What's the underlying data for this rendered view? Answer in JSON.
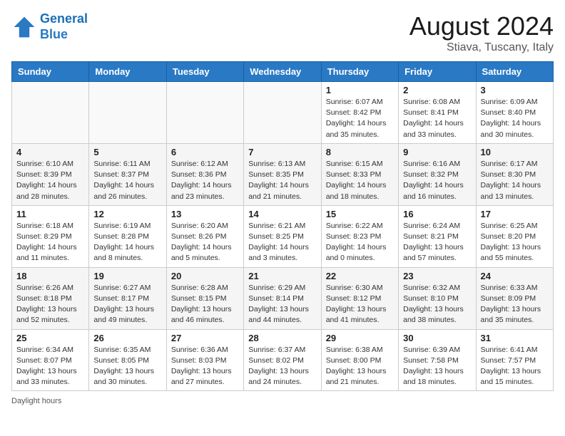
{
  "header": {
    "logo_line1": "General",
    "logo_line2": "Blue",
    "month": "August 2024",
    "location": "Stiava, Tuscany, Italy"
  },
  "weekdays": [
    "Sunday",
    "Monday",
    "Tuesday",
    "Wednesday",
    "Thursday",
    "Friday",
    "Saturday"
  ],
  "weeks": [
    [
      {
        "day": "",
        "info": ""
      },
      {
        "day": "",
        "info": ""
      },
      {
        "day": "",
        "info": ""
      },
      {
        "day": "",
        "info": ""
      },
      {
        "day": "1",
        "info": "Sunrise: 6:07 AM\nSunset: 8:42 PM\nDaylight: 14 hours\nand 35 minutes."
      },
      {
        "day": "2",
        "info": "Sunrise: 6:08 AM\nSunset: 8:41 PM\nDaylight: 14 hours\nand 33 minutes."
      },
      {
        "day": "3",
        "info": "Sunrise: 6:09 AM\nSunset: 8:40 PM\nDaylight: 14 hours\nand 30 minutes."
      }
    ],
    [
      {
        "day": "4",
        "info": "Sunrise: 6:10 AM\nSunset: 8:39 PM\nDaylight: 14 hours\nand 28 minutes."
      },
      {
        "day": "5",
        "info": "Sunrise: 6:11 AM\nSunset: 8:37 PM\nDaylight: 14 hours\nand 26 minutes."
      },
      {
        "day": "6",
        "info": "Sunrise: 6:12 AM\nSunset: 8:36 PM\nDaylight: 14 hours\nand 23 minutes."
      },
      {
        "day": "7",
        "info": "Sunrise: 6:13 AM\nSunset: 8:35 PM\nDaylight: 14 hours\nand 21 minutes."
      },
      {
        "day": "8",
        "info": "Sunrise: 6:15 AM\nSunset: 8:33 PM\nDaylight: 14 hours\nand 18 minutes."
      },
      {
        "day": "9",
        "info": "Sunrise: 6:16 AM\nSunset: 8:32 PM\nDaylight: 14 hours\nand 16 minutes."
      },
      {
        "day": "10",
        "info": "Sunrise: 6:17 AM\nSunset: 8:30 PM\nDaylight: 14 hours\nand 13 minutes."
      }
    ],
    [
      {
        "day": "11",
        "info": "Sunrise: 6:18 AM\nSunset: 8:29 PM\nDaylight: 14 hours\nand 11 minutes."
      },
      {
        "day": "12",
        "info": "Sunrise: 6:19 AM\nSunset: 8:28 PM\nDaylight: 14 hours\nand 8 minutes."
      },
      {
        "day": "13",
        "info": "Sunrise: 6:20 AM\nSunset: 8:26 PM\nDaylight: 14 hours\nand 5 minutes."
      },
      {
        "day": "14",
        "info": "Sunrise: 6:21 AM\nSunset: 8:25 PM\nDaylight: 14 hours\nand 3 minutes."
      },
      {
        "day": "15",
        "info": "Sunrise: 6:22 AM\nSunset: 8:23 PM\nDaylight: 14 hours\nand 0 minutes."
      },
      {
        "day": "16",
        "info": "Sunrise: 6:24 AM\nSunset: 8:21 PM\nDaylight: 13 hours\nand 57 minutes."
      },
      {
        "day": "17",
        "info": "Sunrise: 6:25 AM\nSunset: 8:20 PM\nDaylight: 13 hours\nand 55 minutes."
      }
    ],
    [
      {
        "day": "18",
        "info": "Sunrise: 6:26 AM\nSunset: 8:18 PM\nDaylight: 13 hours\nand 52 minutes."
      },
      {
        "day": "19",
        "info": "Sunrise: 6:27 AM\nSunset: 8:17 PM\nDaylight: 13 hours\nand 49 minutes."
      },
      {
        "day": "20",
        "info": "Sunrise: 6:28 AM\nSunset: 8:15 PM\nDaylight: 13 hours\nand 46 minutes."
      },
      {
        "day": "21",
        "info": "Sunrise: 6:29 AM\nSunset: 8:14 PM\nDaylight: 13 hours\nand 44 minutes."
      },
      {
        "day": "22",
        "info": "Sunrise: 6:30 AM\nSunset: 8:12 PM\nDaylight: 13 hours\nand 41 minutes."
      },
      {
        "day": "23",
        "info": "Sunrise: 6:32 AM\nSunset: 8:10 PM\nDaylight: 13 hours\nand 38 minutes."
      },
      {
        "day": "24",
        "info": "Sunrise: 6:33 AM\nSunset: 8:09 PM\nDaylight: 13 hours\nand 35 minutes."
      }
    ],
    [
      {
        "day": "25",
        "info": "Sunrise: 6:34 AM\nSunset: 8:07 PM\nDaylight: 13 hours\nand 33 minutes."
      },
      {
        "day": "26",
        "info": "Sunrise: 6:35 AM\nSunset: 8:05 PM\nDaylight: 13 hours\nand 30 minutes."
      },
      {
        "day": "27",
        "info": "Sunrise: 6:36 AM\nSunset: 8:03 PM\nDaylight: 13 hours\nand 27 minutes."
      },
      {
        "day": "28",
        "info": "Sunrise: 6:37 AM\nSunset: 8:02 PM\nDaylight: 13 hours\nand 24 minutes."
      },
      {
        "day": "29",
        "info": "Sunrise: 6:38 AM\nSunset: 8:00 PM\nDaylight: 13 hours\nand 21 minutes."
      },
      {
        "day": "30",
        "info": "Sunrise: 6:39 AM\nSunset: 7:58 PM\nDaylight: 13 hours\nand 18 minutes."
      },
      {
        "day": "31",
        "info": "Sunrise: 6:41 AM\nSunset: 7:57 PM\nDaylight: 13 hours\nand 15 minutes."
      }
    ]
  ],
  "footer": "Daylight hours"
}
